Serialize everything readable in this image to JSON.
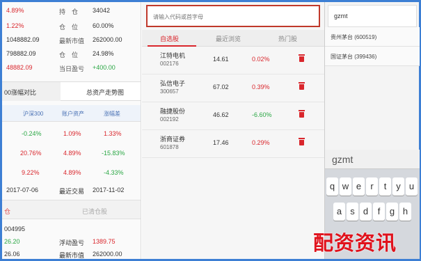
{
  "account": {
    "rows": [
      {
        "v1": "4.89%",
        "v1_color": "red",
        "k2": "持　仓",
        "v2": "34042"
      },
      {
        "v1": "1.22%",
        "v1_color": "red",
        "k2": "仓　位",
        "v2": "60.00%"
      },
      {
        "v1": "1048882.09",
        "v1_color": "dark",
        "k2": "最新市值",
        "v2": "262000.00"
      },
      {
        "v1": "798882.09",
        "v1_color": "dark",
        "k2": "仓　位",
        "v2": "24.98%"
      },
      {
        "v1": "48882.09",
        "v1_color": "red",
        "k2": "当日盈亏",
        "v2": "+400.00",
        "v2_color": "green"
      }
    ]
  },
  "compare_tabs": {
    "tab1": "00涨幅对比",
    "tab2": "总资产走势图"
  },
  "compare_headers": [
    "沪深300",
    "账户资产",
    "涨幅差"
  ],
  "compare_rows": [
    {
      "a": "-0.24%",
      "a_color": "green",
      "b": "1.09%",
      "b_color": "red",
      "c": "1.33%",
      "c_color": "red"
    },
    {
      "a": "20.76%",
      "a_color": "red",
      "b": "4.89%",
      "b_color": "red",
      "c": "-15.83%",
      "c_color": "green"
    },
    {
      "a": "9.22%",
      "a_color": "red",
      "b": "4.89%",
      "b_color": "red",
      "c": "-4.33%",
      "c_color": "green"
    }
  ],
  "dates_row": {
    "d1": "2017-07-06",
    "label": "最近交易",
    "d2": "2017-11-02"
  },
  "position_tabs": {
    "active": "仓",
    "inactive": "已清仓股"
  },
  "position": {
    "code": "004995",
    "r1_v": "26.20",
    "r1_k": "浮动盈亏",
    "r1_v2": "1389.75",
    "r2_v": "26.06",
    "r2_k": "最新市值",
    "r2_v2": "262000.00"
  },
  "search": {
    "placeholder": "请输入代码或首字母"
  },
  "watch_tabs": {
    "t1": "自选股",
    "t2": "最近浏览",
    "t3": "热门股"
  },
  "watchlist": [
    {
      "name": "江特电机",
      "code": "002176",
      "price": "14.61",
      "pct": "0.02%",
      "pct_color": "red"
    },
    {
      "name": "弘信电子",
      "code": "300657",
      "price": "67.02",
      "pct": "0.39%",
      "pct_color": "red"
    },
    {
      "name": "融捷股份",
      "code": "002192",
      "price": "46.62",
      "pct": "-6.60%",
      "pct_color": "green"
    },
    {
      "name": "浙商证券",
      "code": "601878",
      "price": "17.46",
      "pct": "0.29%",
      "pct_color": "red"
    }
  ],
  "right": {
    "query": "gzmt",
    "results": [
      "贵州茅台 (600519)",
      "国证茅台 (399436)"
    ],
    "kb_input": "gzmt",
    "keys_row1": [
      "q",
      "w",
      "e",
      "r",
      "t",
      "y",
      "u"
    ],
    "keys_row2": [
      "a",
      "s",
      "d",
      "f",
      "g",
      "h"
    ]
  },
  "watermark": "配资资讯",
  "colors": {
    "red": "#d9262c",
    "green": "#2aa744",
    "accent_blue": "#3d7fd4"
  }
}
